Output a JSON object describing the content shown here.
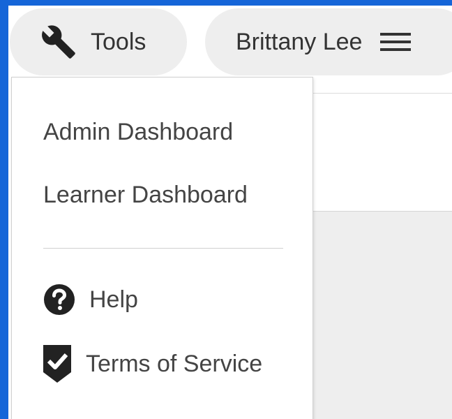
{
  "header": {
    "tools_button": {
      "label": "Tools",
      "icon": "wrench-icon"
    },
    "user_button": {
      "label": "Brittany Lee",
      "icon": "hamburger-menu-icon"
    }
  },
  "tools_menu": {
    "items": [
      {
        "label": "Admin Dashboard"
      },
      {
        "label": "Learner Dashboard"
      },
      {
        "label": "Help",
        "icon": "question-circle-icon"
      },
      {
        "label": "Terms of Service",
        "icon": "shield-check-icon"
      }
    ]
  },
  "colors": {
    "frame_border": "#1565d8",
    "pill_background": "#eeeeee",
    "text": "#444444",
    "icon": "#222222"
  }
}
